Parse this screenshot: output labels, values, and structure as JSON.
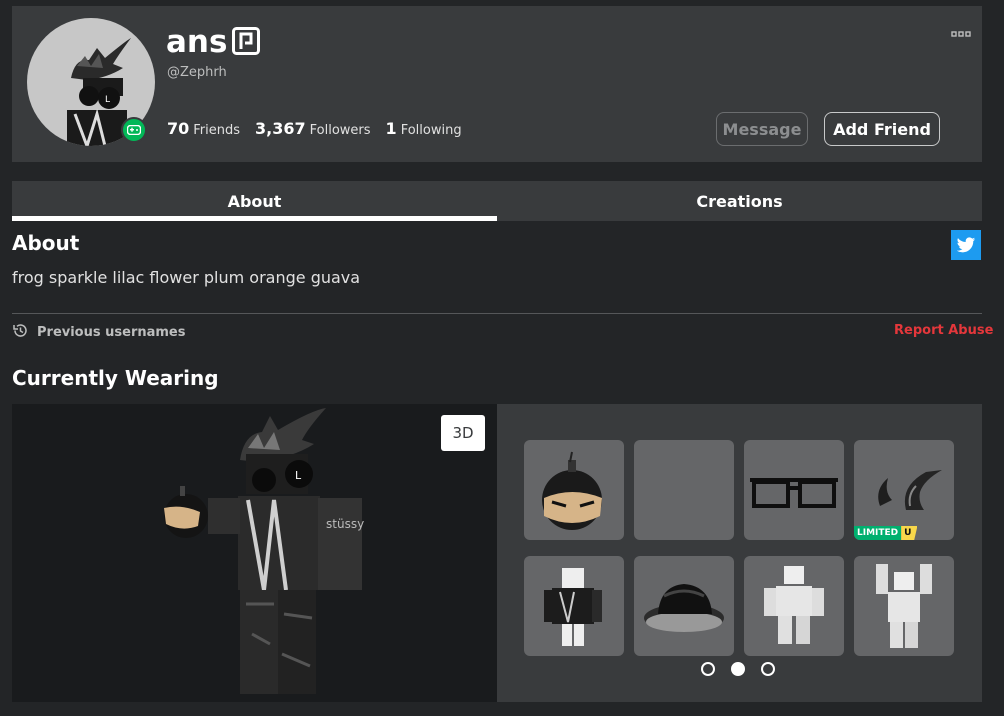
{
  "profile": {
    "display_name": "ans",
    "username": "@Zephrh",
    "stats": [
      {
        "value": "70",
        "label": "Friends"
      },
      {
        "value": "3,367",
        "label": "Followers"
      },
      {
        "value": "1",
        "label": "Following"
      }
    ],
    "message_label": "Message",
    "add_friend_label": "Add Friend",
    "presence": "In Game"
  },
  "tabs": [
    {
      "label": "About",
      "active": true
    },
    {
      "label": "Creations",
      "active": false
    }
  ],
  "about": {
    "title": "About",
    "description": "frog sparkle lilac flower plum orange guava",
    "previous_usernames_label": "Previous usernames",
    "report_abuse_label": "Report Abuse"
  },
  "wearing": {
    "title": "Currently Wearing",
    "view_mode_label": "3D",
    "items": [
      {
        "icon": "bomb-head-icon"
      },
      {
        "icon": "empty-item"
      },
      {
        "icon": "glasses-icon"
      },
      {
        "icon": "horns-icon",
        "badge": {
          "text": "LIMITED",
          "u": "U"
        }
      },
      {
        "icon": "shirt-avatar-icon"
      },
      {
        "icon": "hat-icon"
      },
      {
        "icon": "avatar-pose-icon"
      },
      {
        "icon": "avatar-arms-up-icon"
      }
    ],
    "pagination": {
      "pages": 3,
      "current": 2
    }
  },
  "colors": {
    "background": "#232527",
    "card": "#393b3d",
    "presence": "#02b757",
    "report": "#e4373b",
    "twitter": "#1d9bf0",
    "limited": "#00b06f",
    "limited_u": "#f8d74a"
  }
}
